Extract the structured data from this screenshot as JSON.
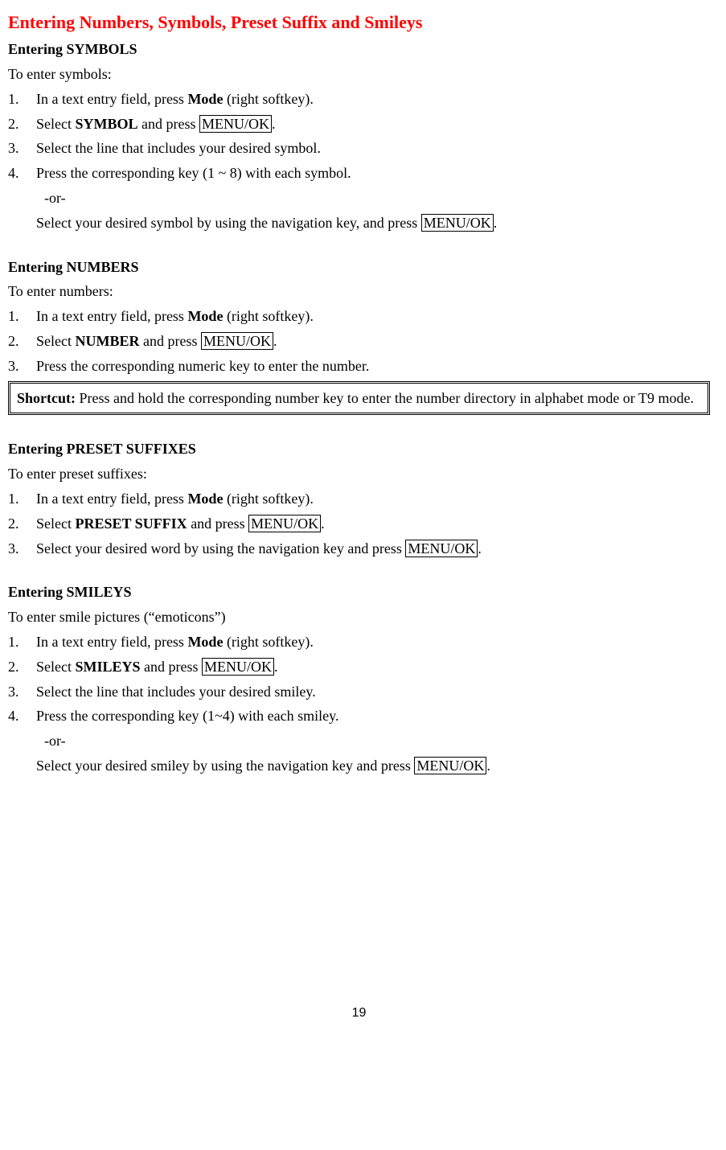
{
  "main_title": "Entering Numbers, Symbols, Preset Suffix and Smileys",
  "symbols": {
    "heading": "Entering SYMBOLS",
    "intro": "To enter symbols:",
    "step1_pre": "In a text entry field, press ",
    "step1_bold": "Mode",
    "step1_post": " (right softkey).",
    "step2_pre": "Select ",
    "step2_bold": "SYMBOL",
    "step2_mid": " and press ",
    "step2_key": "MENU/OK",
    "step2_post": ".",
    "step3": "Select the line that includes your desired symbol.",
    "step4": "Press the corresponding key (1 ~ 8) with each symbol.",
    "or": "-or-",
    "alt_pre": "Select your desired symbol by using the navigation key, and press ",
    "alt_key": "MENU/OK",
    "alt_post": "."
  },
  "numbers_sec": {
    "heading": "Entering NUMBERS",
    "intro": "To enter numbers:",
    "step1_pre": "In a text entry field, press ",
    "step1_bold": "Mode",
    "step1_post": " (right softkey).",
    "step2_pre": "Select ",
    "step2_bold": "NUMBER",
    "step2_mid": " and press ",
    "step2_key": "MENU/OK",
    "step2_post": ".",
    "step3": "Press the corresponding numeric key to enter the number.",
    "shortcut_label": "Shortcut:",
    "shortcut_text": " Press and hold the corresponding number key to enter the number directory in alphabet mode or T9 mode."
  },
  "preset": {
    "heading": "Entering PRESET SUFFIXES",
    "intro": "To enter preset suffixes:",
    "step1_pre": "In a text entry field, press ",
    "step1_bold": "Mode",
    "step1_post": " (right softkey).",
    "step2_pre": "Select ",
    "step2_bold": "PRESET SUFFIX",
    "step2_mid": " and press ",
    "step2_key": "MENU/OK",
    "step2_post": ".",
    "step3_pre": "Select your desired word by using the navigation key and press ",
    "step3_key": "MENU/OK",
    "step3_post": "."
  },
  "smileys": {
    "heading": "Entering SMILEYS",
    "intro": "To enter smile pictures (“emoticons”)",
    "step1_pre": "In a text entry field, press ",
    "step1_bold": "Mode",
    "step1_post": " (right softkey).",
    "step2_pre": "Select ",
    "step2_bold": "SMILEYS",
    "step2_mid": " and press ",
    "step2_key": "MENU/OK",
    "step2_post": ".",
    "step3": "Select the line that includes your desired smiley.",
    "step4": "Press the corresponding key (1~4) with each smiley.",
    "or": "-or-",
    "alt_pre": "Select your desired smiley by using the navigation key and press ",
    "alt_key": "MENU/OK",
    "alt_post": "."
  },
  "nums": {
    "n1": "1.",
    "n2": "2.",
    "n3": "3.",
    "n4": "4."
  },
  "page_number": "19"
}
